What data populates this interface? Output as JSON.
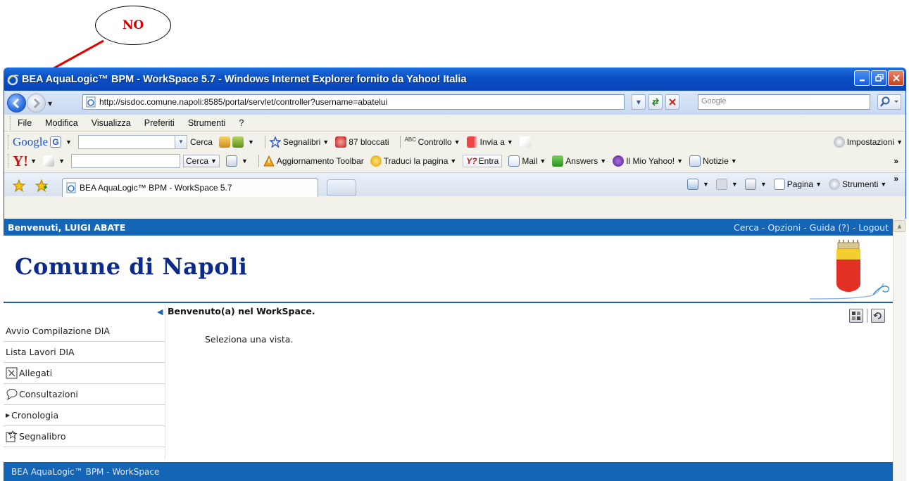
{
  "annotation": {
    "label": "NO"
  },
  "window": {
    "title": "BEA AquaLogic™ BPM - WorkSpace 5.7 - Windows Internet Explorer fornito da Yahoo! Italia",
    "colors": {
      "titlebar": "#0a4fc4",
      "page_bar": "#1565b6"
    }
  },
  "address": {
    "url": "http://sisdoc.comune.napoli:8585/portal/servlet/controller?username=abatelui",
    "search_placeholder": "Google"
  },
  "menu": [
    "File",
    "Modifica",
    "Visualizza",
    "Preferiti",
    "Strumenti",
    "?"
  ],
  "google_toolbar": {
    "brand": "Google",
    "search_label": "Cerca",
    "bookmarks": "Segnalibri",
    "blocked": "87 bloccati",
    "check": "Controllo",
    "send": "Invia a",
    "settings": "Impostazioni"
  },
  "yahoo_toolbar": {
    "brand": "Y!",
    "search_label": "Cerca",
    "update": "Aggiornamento Toolbar",
    "translate": "Traduci la pagina",
    "login": "Entra",
    "mail": "Mail",
    "answers": "Answers",
    "my_yahoo": "Il Mio Yahoo!",
    "news": "Notizie",
    "more": "»"
  },
  "tabs": {
    "active_label": "BEA AquaLogic™ BPM - WorkSpace 5.7"
  },
  "command_bar": {
    "page": "Pagina",
    "tools": "Strumenti",
    "more": "»"
  },
  "page": {
    "welcome": "Benvenuti, LUIGI ABATE",
    "top_links": [
      "Cerca",
      "Opzioni",
      "Guida (?)",
      "Logout"
    ],
    "link_separator": " - ",
    "banner_title": "Comune di Napoli",
    "content_title": "Benvenuto(a) nel WorkSpace.",
    "content_message": "Seleziona una vista.",
    "sidebar_items": [
      {
        "label": "Avvio Compilazione DIA",
        "icon": "none"
      },
      {
        "label": "Lista Lavori DIA",
        "icon": "none"
      },
      {
        "label": "Allegati",
        "icon": "attachments-icon"
      },
      {
        "label": "Consultazioni",
        "icon": "speech-bubble-icon"
      },
      {
        "label": "Cronologia",
        "icon": "expand-triangle-icon"
      },
      {
        "label": "Segnalibro",
        "icon": "bookmark-icon"
      }
    ],
    "footer": "BEA AquaLogic™ BPM - WorkSpace"
  }
}
